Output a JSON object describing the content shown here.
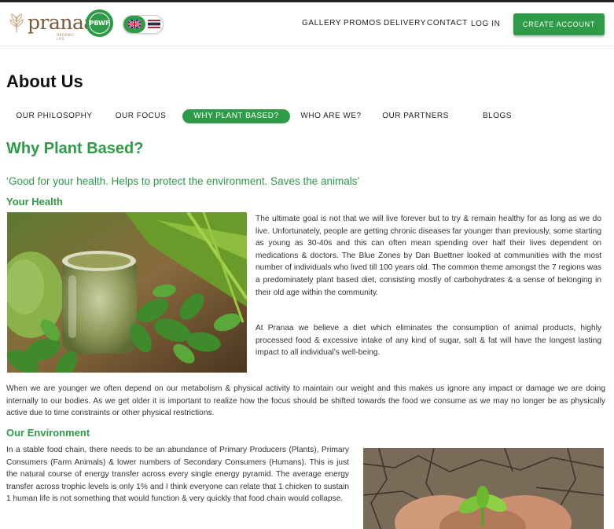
{
  "header": {
    "logo_text": "pranaa",
    "logo_sub": "ORGANIC LIFE",
    "badge_text": "PBWF",
    "nav": {
      "gallery": "GALLERY",
      "promos": "PROMOS",
      "delivery": "DELIVERY",
      "contact": "CONTACT",
      "login": "LOG IN"
    },
    "cta_label": "CREATE ACCOUNT"
  },
  "page": {
    "title": "About Us",
    "tabs": [
      {
        "label": "OUR PHILOSOPHY",
        "active": false
      },
      {
        "label": "OUR FOCUS",
        "active": false
      },
      {
        "label": "WHY PLANT BASED?",
        "active": true
      },
      {
        "label": "WHO ARE WE?",
        "active": false
      },
      {
        "label": "OUR PARTNERS",
        "active": false
      },
      {
        "label": "BLOGS",
        "active": false
      }
    ]
  },
  "content": {
    "heading": "Why Plant Based?",
    "quote": "‘Good for your health. Helps to protect the environment. Saves the animals’",
    "health_heading": "Your Health",
    "health_p1": "The ultimate goal is not that we will live forever but to try & remain healthy for as long as we do live. Unfortunately, people are getting chronic diseases far younger than previously, some starting as young as 30-40s and this can often mean spending over half their lives dependent on medications & doctors. The Blue Zones by Dan Buettner looked at communities with the most number of individuals who lived till 100 years old. The common theme amongst the 7 regions was a predominately plant based diet, consisting mostly of carbohydrates & a sense of belonging in their old age within the community.",
    "health_p2": "At Pranaa we believe a diet which eliminates the consumption of animal products, highly processed food & excessive intake of any kind of sugar, salt & fat will have the longest lasting impact to all individual’s well-being.",
    "metabolism_p": "When we are younger we often depend on our metabolism & physical activity to maintain our weight and this makes us ignore any impact or damage we are doing internally to our bodies. As we get older it is important to realize how the focus should be shifted towards the food we consume as we may no longer be as physically active due to time constraints or other physical restrictions.",
    "env_heading": "Our Environment",
    "env_p": "In a stable food chain, there needs to be an abundance of Primary Producers (Plants), Primary Consumers (Farm Animals) & lower numbers of Secondary Consumers (Humans). This is just the natural course of energy transfer across every single energy pyramid. The average energy transfer across trophic levels is only 1% and I think everyone can relate that 1 chicken to sustain 1 human life is not something that would function & very quickly that food chain would collapse."
  },
  "colors": {
    "brand_green": "#2f9a47",
    "logo_brown": "#7a5a3a"
  }
}
